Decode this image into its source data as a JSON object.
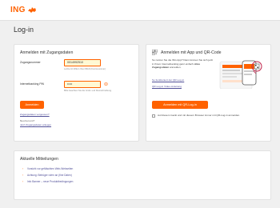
{
  "brand": {
    "logo_text": "ING"
  },
  "page_title": "Log-in",
  "login_card": {
    "title": "Anmelden mit Zugangsdaten",
    "account_label": "Zugangsnummer",
    "account_value": "0014992510",
    "account_hint": "Letzte 10 Ziffern Ihrer IBAN (Kontonummer)",
    "pin_label": "Internetbanking PIN",
    "pin_value": "•••••",
    "pin_hint": "Bitte beachten Sie die Groß- und Kleinschreibung.",
    "login_button": "Anmelden",
    "forgot_link": "Zugangsdaten vergessen?",
    "new_label": "Neu bei uns?",
    "setup_link": "Jetzt Zugangsdaten anlegen"
  },
  "app_card": {
    "title": "Anmelden mit App und QR-Code",
    "text_1": "So nutzen Sie die ING App? Dann können Sie sich jetzt in Ihrem Internetbanking ganz einfach ",
    "text_bold": "ohne Zugangsdaten",
    "text_2": " anmelden.",
    "switch_link": "So funktioniert der QR-Log-in",
    "video_link": "QR-Log-in Video-Anleitung",
    "qr_button": "Anmelden mit QR-Log-in",
    "remember_label": "Auf diesem Gerät und mit diesem Browser immer mit QR-Log-in anmelden."
  },
  "news_card": {
    "title": "Aktuelle Mitteilungen",
    "items": [
      "Vorsicht vor gefälschten Web-Webseiten",
      "Achtung: Betrüger rufen an (fine Daten)",
      "Info Banner – neue Produktbedingungen"
    ]
  },
  "colors": {
    "accent": "#ff6200",
    "link": "#525199",
    "input_bg": "#fff9d4",
    "page_bg": "#f0f0f0"
  }
}
